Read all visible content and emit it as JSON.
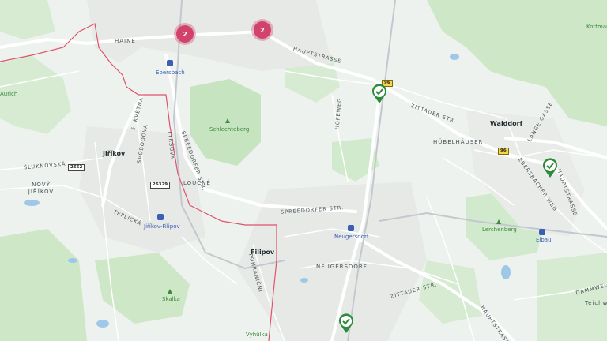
{
  "colors": {
    "background": "#eef2ee",
    "forest": "#cde7c7",
    "park": "#bfe0b3",
    "water": "#9fc7e7",
    "road": "#ffffff",
    "railway": "#c3c8cf",
    "border": "#e0526a",
    "cluster": "#d2436b",
    "checkpoint": "#2e8b3a"
  },
  "towns": [
    "Haine",
    "Ebersbach",
    "Jiříkov",
    "Nový Jiříkov",
    "Loučné",
    "Filipov",
    "Neugersdorf",
    "Walddorf",
    "Hübelhäuser",
    "Eibau",
    "Lerchenberg",
    "Schlechteberg",
    "Jiříkov-Filipov",
    "Skalka",
    "Výhůlka",
    "Kottmar",
    "Teichw"
  ],
  "streets": [
    "HAUPTSTRASSE",
    "ZITTAUER STR.",
    "SPREEDORFER STR.",
    "SPREEDORFER STR.",
    "HOFEWEG",
    "ŠLUKNOVSKÁ",
    "TEPLICKÁ",
    "SVOBODOVA",
    "5. KVĚTNA",
    "TYRŠOVA",
    "POHRANIČNÍ",
    "LANGE GASSE",
    "EBERSBACHER WEG",
    "HAUPTSTRASSE",
    "ZITTAUER STR.",
    "HAUPTSTRASSE",
    "DAMMWEG"
  ],
  "districts": [
    "HAINE",
    "LOUČNÉ",
    "NOVÝ JIŘÍKOV",
    "NEUGERSDORF",
    "HÜBELHÄUSER"
  ],
  "town_labels": [
    "Jiříkov",
    "Filipov",
    "Walddorf"
  ],
  "pois": [
    "Schlechteberg",
    "Lerchenberg",
    "Skalka",
    "Výhůlka",
    "Kottmar"
  ],
  "stations": [
    "Ebersbach",
    "Jiříkov-Filipov",
    "Neugersdorf",
    "Eibau"
  ],
  "road_shields": [
    "96",
    "96",
    "2662",
    "26329"
  ],
  "clusters": [
    {
      "count": "2"
    },
    {
      "count": "2"
    }
  ],
  "checkpoints": [
    {
      "icon": "check-icon"
    },
    {
      "icon": "check-icon"
    },
    {
      "icon": "check-icon"
    }
  ],
  "misc": [
    "Teichw",
    "Aurich"
  ]
}
